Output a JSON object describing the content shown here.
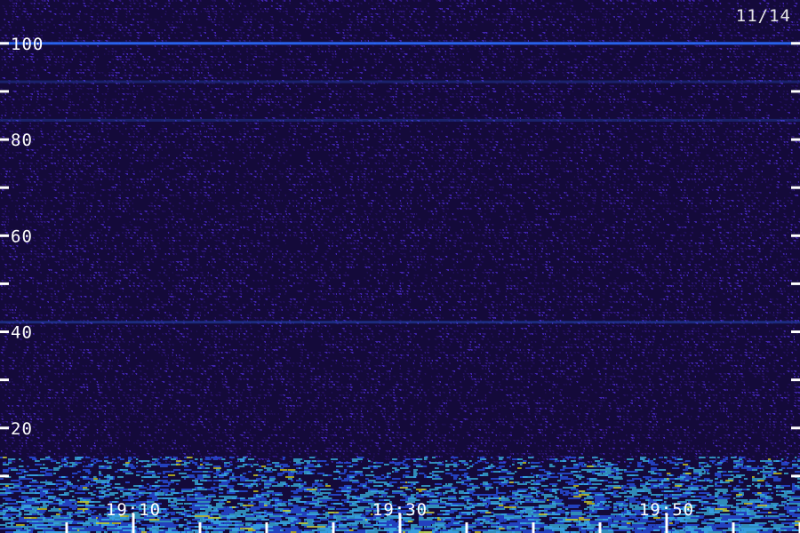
{
  "chart_data": {
    "type": "heatmap",
    "date_label": "11/14",
    "y_ticks_labeled": [
      20,
      40,
      60,
      80,
      100
    ],
    "y_ticks_minor": [
      10,
      30,
      50,
      70,
      90
    ],
    "ylim": [
      0,
      102
    ],
    "x_tick_labels": [
      "19:10",
      "19:30",
      "19:50"
    ],
    "x_ticks_minutes": [
      5,
      10,
      15,
      20,
      25,
      30,
      35,
      40,
      45,
      50,
      55,
      60
    ],
    "xlim_minutes": [
      0,
      60
    ],
    "x_label_minutes": [
      10,
      30,
      50
    ],
    "noise_bands": [
      {
        "level": 100,
        "strength": 0.9
      },
      {
        "level": 92,
        "strength": 0.25
      },
      {
        "level": 84,
        "strength": 0.25
      },
      {
        "level": 42,
        "strength": 0.35
      }
    ],
    "activity_band": [
      0,
      14
    ],
    "colors": {
      "background": "#140a3a",
      "noise_low": "#2a1470",
      "noise_high": "#4a2cc8",
      "band": "#2a6cff",
      "active_cyan": "#3fd6ff",
      "active_yellow": "#e6e61a",
      "tick": "#ffffff"
    }
  }
}
